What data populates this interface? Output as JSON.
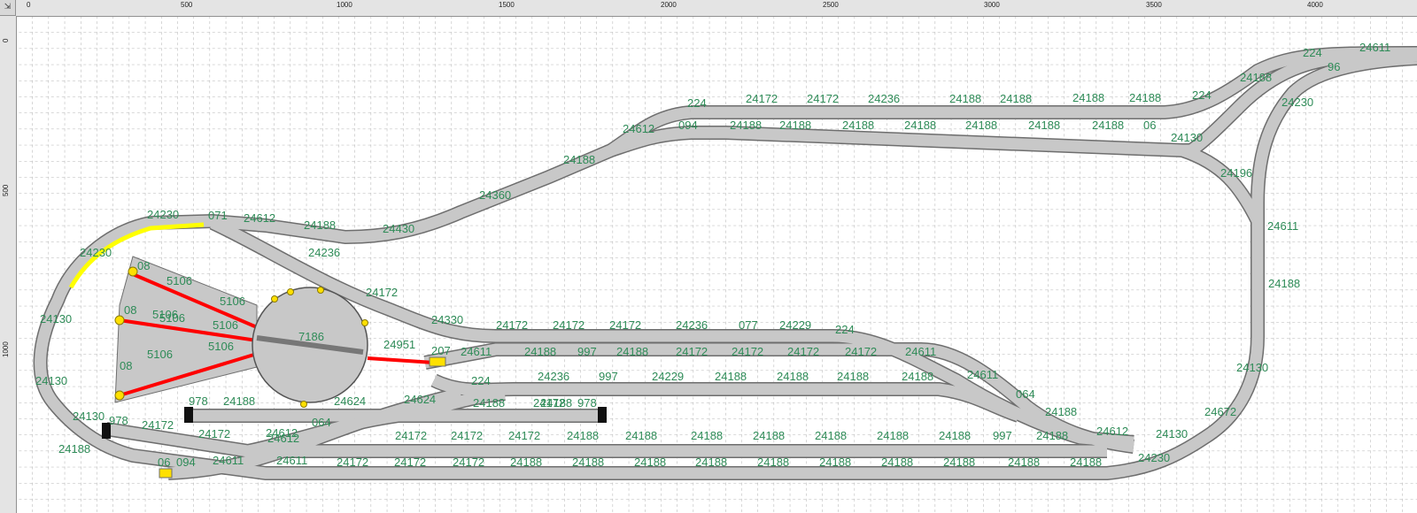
{
  "ruler": {
    "corner_label": "⇲",
    "top_labels": [
      "0",
      "500",
      "1000",
      "1500",
      "2000",
      "2500",
      "3000",
      "3500",
      "4000"
    ],
    "left_labels": [
      "0",
      "500",
      "1000"
    ]
  },
  "track_labels": [
    "24611",
    "224",
    "24188",
    "96",
    "24230",
    "24130",
    "224",
    "24188",
    "24188",
    "24188",
    "24188",
    "24236",
    "24172",
    "24172",
    "224",
    "094",
    "24188",
    "24188",
    "24188",
    "24188",
    "24188",
    "24188",
    "24188",
    "06",
    "24612",
    "24188",
    "24360",
    "24230",
    "071",
    "24612",
    "24188",
    "24430",
    "24236",
    "24172",
    "24330",
    "24230",
    "24130",
    "24130",
    "24130",
    "24196",
    "24611",
    "24188",
    "24130",
    "24672",
    "24130",
    "24230",
    "08",
    "5106",
    "5106",
    "08",
    "5106",
    "5106",
    "5106",
    "08",
    "5106",
    "5106",
    "7186",
    "24951",
    "207",
    "24172",
    "24172",
    "24172",
    "24236",
    "077",
    "24229",
    "224",
    "24611",
    "24188",
    "997",
    "24188",
    "24172",
    "24172",
    "24172",
    "24172",
    "24611",
    "224",
    "24236",
    "997",
    "24229",
    "24188",
    "24188",
    "24188",
    "24188",
    "24611",
    "064",
    "24188",
    "24612",
    "978",
    "24188",
    "24624",
    "24624",
    "24188",
    "24188",
    "24172",
    "978",
    "978",
    "24172",
    "24172",
    "24612",
    "064",
    "24172",
    "24172",
    "24172",
    "24188",
    "24188",
    "24188",
    "24188",
    "24188",
    "24188",
    "24188",
    "997",
    "24188",
    "06",
    "094",
    "24611",
    "24611",
    "24612",
    "24172",
    "24172",
    "24172",
    "24188",
    "24188",
    "24188",
    "24188",
    "24188",
    "24188",
    "24188",
    "24188",
    "24188",
    "24188",
    "24188"
  ],
  "colors": {
    "track_fill": "#c8c8c8",
    "track_edge": "#6e6e6e",
    "label": "#2e8b57",
    "selected_track": "#ffff00",
    "turntable_track": "#ff0000",
    "connector": "#ffe000",
    "buffer": "#111111"
  }
}
